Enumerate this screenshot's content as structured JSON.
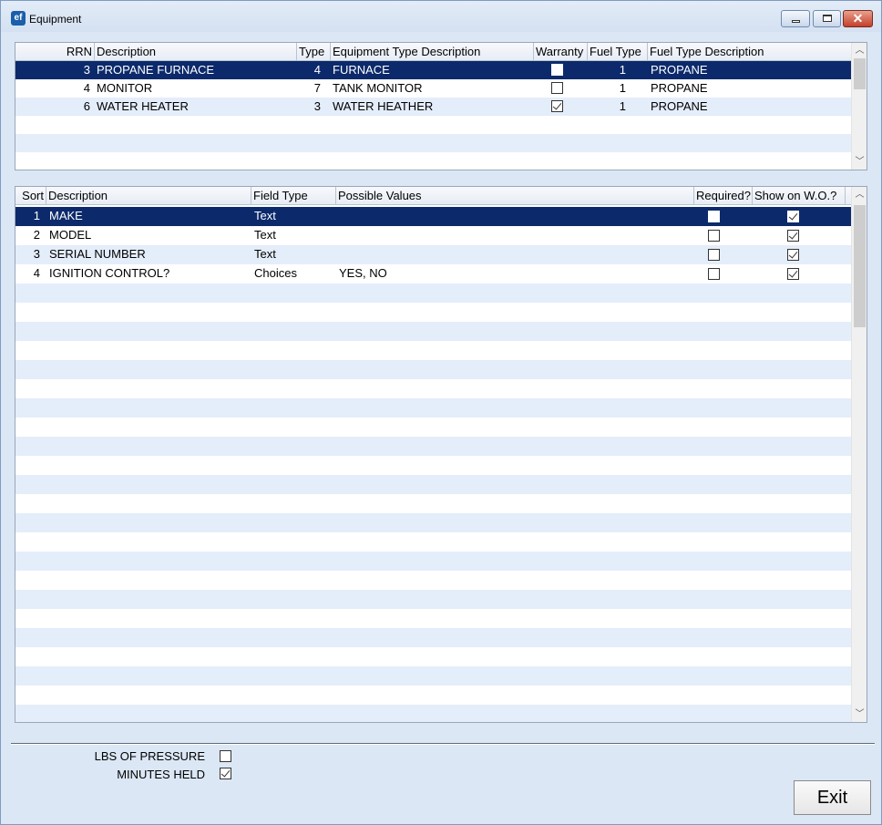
{
  "window": {
    "title": "Equipment",
    "icon_text": "ef"
  },
  "equipment_grid": {
    "columns": [
      "RRN",
      "Description",
      "Type",
      "Equipment Type Description",
      "Warranty",
      "Fuel Type",
      "Fuel Type Description"
    ],
    "rows": [
      {
        "rrn": "3",
        "description": "PROPANE FURNACE",
        "type": "4",
        "type_desc": "FURNACE",
        "warranty": false,
        "fuel_type": "1",
        "fuel_desc": "PROPANE",
        "selected": true
      },
      {
        "rrn": "4",
        "description": "MONITOR",
        "type": "7",
        "type_desc": "TANK MONITOR",
        "warranty": false,
        "fuel_type": "1",
        "fuel_desc": "PROPANE",
        "selected": false
      },
      {
        "rrn": "6",
        "description": "WATER HEATER",
        "type": "3",
        "type_desc": "WATER HEATHER",
        "warranty": true,
        "fuel_type": "1",
        "fuel_desc": "PROPANE",
        "selected": false
      }
    ]
  },
  "fields_grid": {
    "columns": [
      "Sort",
      "Description",
      "Field Type",
      "Possible Values",
      "Required?",
      "Show on W.O.?"
    ],
    "rows": [
      {
        "sort": "1",
        "description": "MAKE",
        "field_type": "Text",
        "values": "",
        "required": false,
        "show": true,
        "selected": true
      },
      {
        "sort": "2",
        "description": "MODEL",
        "field_type": "Text",
        "values": "",
        "required": false,
        "show": true,
        "selected": false
      },
      {
        "sort": "3",
        "description": "SERIAL NUMBER",
        "field_type": "Text",
        "values": "",
        "required": false,
        "show": true,
        "selected": false
      },
      {
        "sort": "4",
        "description": "IGNITION CONTROL?",
        "field_type": "Choices",
        "values": "YES, NO",
        "required": false,
        "show": true,
        "selected": false
      }
    ]
  },
  "footer": {
    "lbs_label": "LBS OF PRESSURE",
    "lbs_checked": false,
    "minutes_label": "MINUTES HELD",
    "minutes_checked": true,
    "exit_label": "Exit"
  },
  "colors": {
    "selection": "#0c2a6b",
    "alt_row": "#e4edfa",
    "frame": "#dbe7f5"
  }
}
